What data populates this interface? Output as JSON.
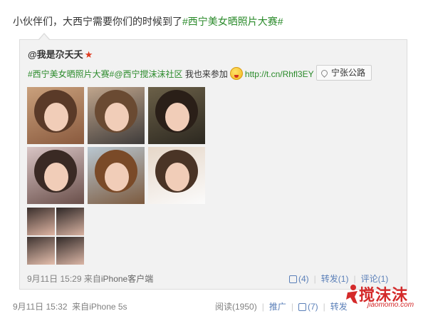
{
  "post": {
    "text_prefix": "小伙伴们，大西宁需要你们的时候到了",
    "topic": "#西宁美女晒照片大赛#"
  },
  "repost": {
    "author": "@我是尕夭夭",
    "star_icon": "star-icon",
    "topic1": "#西宁美女晒照片大赛#",
    "mention": "@西宁搅沫沫社区",
    "text_mid": " 我也来参加",
    "emoji": "emoji-icon",
    "link": "http://t.cn/Rhfl3EY",
    "location": "宁张公路",
    "time": "9月11日 15:29",
    "source_prefix": "来自",
    "source": "iPhone客户端",
    "likes": "(4)",
    "repost_label": "转发(1)",
    "comment_label": "评论(1)"
  },
  "photos": [
    "photo-1",
    "photo-2",
    "photo-3",
    "photo-4",
    "photo-5",
    "photo-6",
    "photo-7"
  ],
  "outer": {
    "time": "9月11日 15:32",
    "source_prefix": "来自",
    "source": "iPhone 5s",
    "reads": "阅读(1950)",
    "promote": "推广",
    "likes": "(7)",
    "repost_label": "转发"
  },
  "watermark": {
    "brand": "搅沫沫",
    "domain": "jiaomomo.com"
  }
}
